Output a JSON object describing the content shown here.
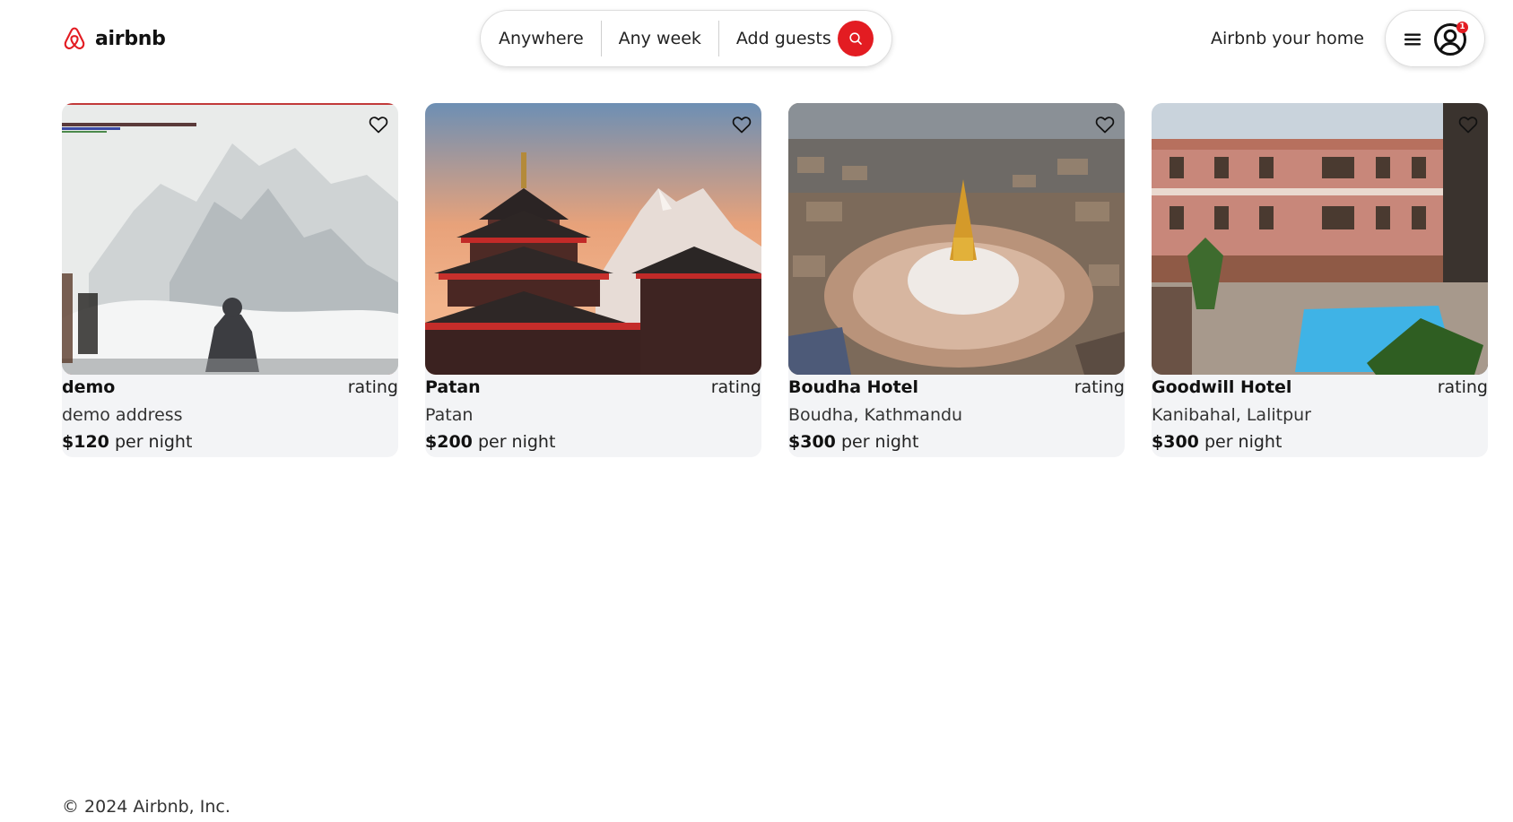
{
  "header": {
    "brand": "airbnb",
    "search": {
      "segments": [
        "Anywhere",
        "Any week",
        "Add guests"
      ]
    },
    "host_link": "Airbnb your home",
    "notification_count": "1"
  },
  "listings": [
    {
      "title": "demo",
      "rating": "rating",
      "address": "demo address",
      "price": "$120",
      "price_unit": "per night"
    },
    {
      "title": "Patan",
      "rating": "rating",
      "address": "Patan",
      "price": "$200",
      "price_unit": "per night"
    },
    {
      "title": "Boudha Hotel",
      "rating": "rating",
      "address": "Boudha, Kathmandu",
      "price": "$300",
      "price_unit": "per night"
    },
    {
      "title": "Goodwill Hotel",
      "rating": "rating",
      "address": "Kanibahal, Lalitpur",
      "price": "$300",
      "price_unit": "per night"
    }
  ],
  "footer": {
    "copyright": "© 2024 Airbnb, Inc."
  },
  "colors": {
    "accent": "#e31c22",
    "card_background": "#f3f4f6"
  }
}
